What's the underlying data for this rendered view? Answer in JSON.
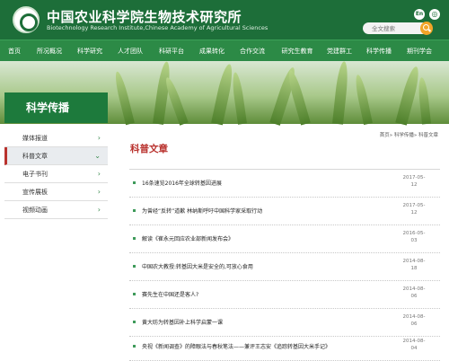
{
  "header": {
    "title_cn": "中国农业科学院生物技术研究所",
    "title_en": "Biotechnology Research Institute,Chinese Academy of Agricultural Sciences",
    "lang_en": "En",
    "search_placeholder": "全文搜索"
  },
  "nav": [
    "首页",
    "所况概况",
    "科学研究",
    "人才团队",
    "科研平台",
    "成果转化",
    "合作交流",
    "研究生教育",
    "党建群工",
    "科学传播",
    "期刊学会"
  ],
  "sidebar": {
    "title": "科学传播",
    "items": [
      {
        "label": "媒体报道",
        "arrow": "›"
      },
      {
        "label": "科普文章",
        "arrow": "⌄"
      },
      {
        "label": "电子书刊",
        "arrow": "›"
      },
      {
        "label": "宣传展板",
        "arrow": "›"
      },
      {
        "label": "视频动画",
        "arrow": "›"
      }
    ]
  },
  "main": {
    "breadcrumb": "首页» 科学传播» 科普文章",
    "title": "科普文章",
    "articles": [
      {
        "title": "16条速览2016年全球转基因进展",
        "date": "2017-05-12"
      },
      {
        "title": "为曾经“反转”道歉 林纳斯呼吁中国科学家采取行动",
        "date": "2017-05-12"
      },
      {
        "title": "解读《崔永元回应农业部新闻发布会》",
        "date": "2016-05-03"
      },
      {
        "title": "中国农大教授:转基因大米是安全的,可放心食用",
        "date": "2014-08-18"
      },
      {
        "title": "赛先生在中国还是客人?",
        "date": "2014-08-06"
      },
      {
        "title": "黄大昉为转基因补上科学启蒙一课",
        "date": "2014-08-06"
      },
      {
        "title": "央视《新闻调查》的障眼法与春秋笔法——兼评王志安《追踪转基因大米手记》",
        "date": "2014-08-04"
      }
    ]
  },
  "colors": {
    "header_green": "#1d6e39",
    "nav_green": "#2c8a46",
    "accent_red": "#b9322e",
    "search_orange": "#f3a528"
  }
}
